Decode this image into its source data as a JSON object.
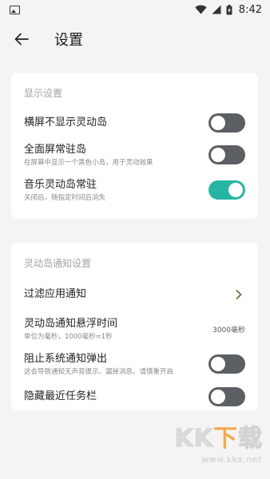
{
  "status_bar": {
    "time": "8:42",
    "icons": [
      "image-icon",
      "wifi-icon",
      "signal-icon",
      "battery-charging-icon"
    ]
  },
  "header": {
    "title": "设置",
    "back_icon": "arrow-left-icon"
  },
  "display_section": {
    "title": "显示设置",
    "items": [
      {
        "title": "横屏不显示灵动岛",
        "subtitle": "",
        "toggle": false
      },
      {
        "title": "全面屏常驻岛",
        "subtitle": "在屏幕中显示一个黑色小岛，用于灵动效果",
        "toggle": false
      },
      {
        "title": "音乐灵动岛常驻",
        "subtitle": "关闭后，随指定时间后消失",
        "toggle": true
      }
    ]
  },
  "notify_section": {
    "title": "灵动岛通知设置",
    "filter": {
      "title": "过滤应用通知",
      "icon": "chevron-right-icon"
    },
    "float_time": {
      "title": "灵动岛通知悬浮时间",
      "subtitle": "单位为毫秒，1000毫秒=1秒",
      "value": "3000毫秒"
    },
    "block": {
      "title": "阻止系统通知弹出",
      "subtitle": "这会导致通知无声音提示、漏掉消息。请慎重开启",
      "toggle": false
    },
    "hide_recents": {
      "title": "隐藏最近任务栏",
      "toggle": false
    }
  },
  "watermark": {
    "logo": [
      "K",
      "K",
      "下",
      "载"
    ],
    "url": "www.kkx.net"
  },
  "colors": {
    "accent": "#27b5a3",
    "toggle_off": "#5c5f63",
    "chevron": "#6b6b3a",
    "background": "#f4f4f4"
  }
}
